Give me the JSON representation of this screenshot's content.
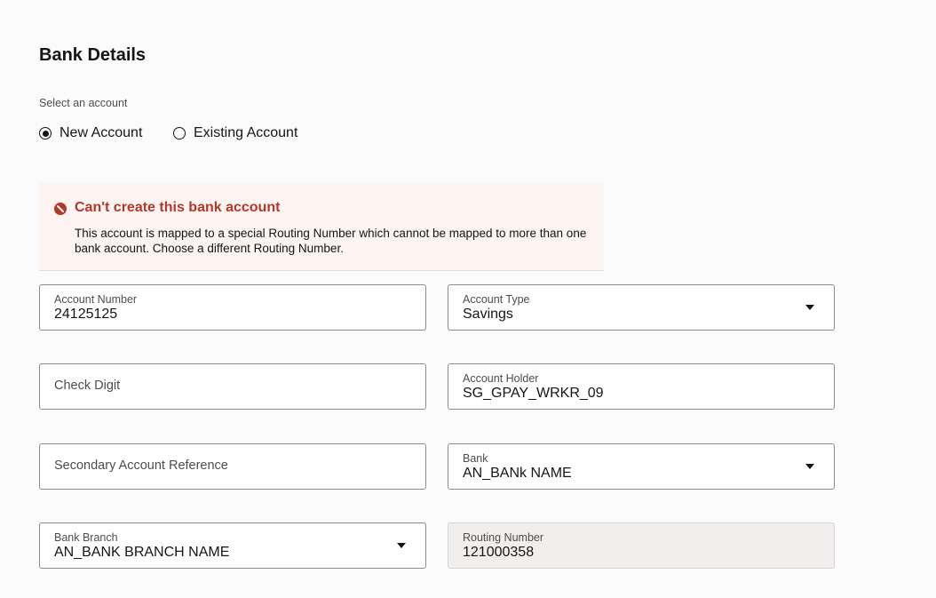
{
  "page": {
    "title": "Bank Details"
  },
  "account_selection": {
    "label": "Select an account",
    "options": [
      {
        "label": "New Account",
        "selected": true
      },
      {
        "label": "Existing Account",
        "selected": false
      }
    ]
  },
  "alert": {
    "icon": "error-icon",
    "color": "#b0392b",
    "title": "Can't create this bank account",
    "message": "This account is mapped to a special Routing Number which cannot be mapped to more than one bank account. Choose a different Routing Number."
  },
  "fields": {
    "account_number": {
      "label": "Account Number",
      "value": "24125125"
    },
    "account_type": {
      "label": "Account Type",
      "value": "Savings"
    },
    "check_digit": {
      "label": "Check Digit",
      "value": ""
    },
    "account_holder": {
      "label": "Account Holder",
      "value": "SG_GPAY_WRKR_09"
    },
    "secondary_reference": {
      "label": "Secondary Account Reference",
      "value": ""
    },
    "bank": {
      "label": "Bank",
      "value": "AN_BANk NAME"
    },
    "bank_branch": {
      "label": "Bank Branch",
      "value": "AN_BANK BRANCH NAME"
    },
    "routing_number": {
      "label": "Routing Number",
      "value": "121000358"
    }
  }
}
